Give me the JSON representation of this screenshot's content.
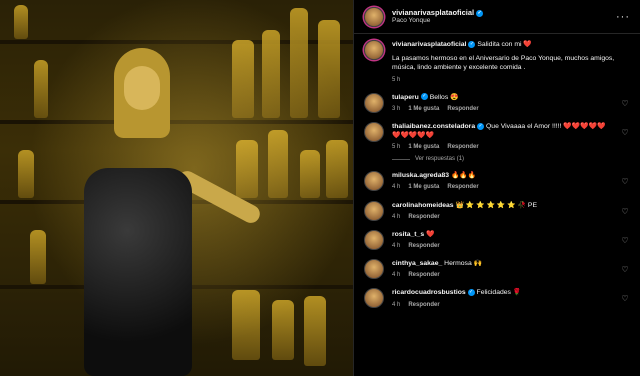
{
  "post": {
    "author": "vivianarivasplataoficial",
    "location": "Paco Yonque",
    "more_icon": "ellipsis-icon"
  },
  "caption": {
    "author": "vivianarivasplataoficial",
    "text": "Salidita con mi ❤️",
    "body": "La pasamos hermoso en el Aniversario de Paco Yonque, muchos amigos, música, lindo ambiente y excelente comida .",
    "time": "5 h"
  },
  "comments": [
    {
      "user": "tulaperu",
      "verified": true,
      "text": "Bellos 😍",
      "time": "3 h",
      "likes": "1 Me gusta",
      "reply": "Responder"
    },
    {
      "user": "thaliaibanez.consteladora",
      "verified": true,
      "text": "Que Vivaaaa el Amor !!!!! ❤️❤️❤️❤️❤️❤️❤️❤️❤️❤️",
      "time": "5 h",
      "likes": "1 Me gusta",
      "reply": "Responder",
      "view_replies": "Ver respuestas (1)"
    },
    {
      "user": "miluska.agreda83",
      "verified": false,
      "text": "🔥🔥🔥",
      "time": "4 h",
      "likes": "1 Me gusta",
      "reply": "Responder"
    },
    {
      "user": "carolinahomeideas",
      "verified": false,
      "text": "👑 ⭐ ⭐ ⭐ ⭐ ⭐ 🥀 PE",
      "time": "4 h",
      "likes": "",
      "reply": "Responder"
    },
    {
      "user": "rosita_t_s",
      "verified": false,
      "text": "❤️",
      "time": "4 h",
      "likes": "",
      "reply": "Responder"
    },
    {
      "user": "cinthya_sakae_",
      "verified": false,
      "text": "Hermosa 🙌",
      "time": "4 h",
      "likes": "",
      "reply": "Responder"
    },
    {
      "user": "ricardocuadrosbustios",
      "verified": true,
      "text": "Felicidades 🌹",
      "time": "4 h",
      "likes": "",
      "reply": "Responder"
    }
  ],
  "colors": {
    "background": "#000000",
    "text": "#f5f5f5",
    "muted": "#a8a8a8",
    "verified": "#0095f6"
  }
}
